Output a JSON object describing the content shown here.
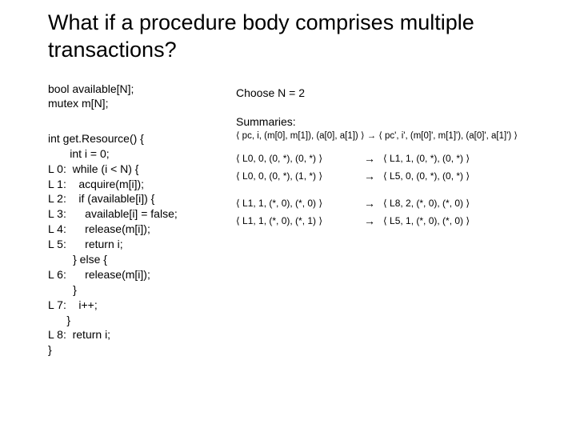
{
  "title": "What if a procedure body comprises multiple transactions?",
  "decl": {
    "line1": "bool available[N];",
    "line2": "mutex m[N];"
  },
  "code": "int get.Resource() {\n       int i = 0;\nL 0:  while (i < N) {\nL 1:    acquire(m[i]);\nL 2:    if (available[i]) {\nL 3:      available[i] = false;\nL 4:      release(m[i]);\nL 5:      return i;\n        } else {\nL 6:      release(m[i]);\n        }\nL 7:    i++;\n      }\nL 8:  return i;\n}",
  "choose": "Choose N = 2",
  "summaries_label": "Summaries:",
  "sum_first": "⟨ pc, i, (m[0], m[1]), (a[0], a[1]) ⟩ → ⟨ pc', i', (m[0]', m[1]'), (a[0]', a[1]') ⟩",
  "group1": {
    "row1": {
      "lhs": "⟨ L0, 0, (0, *), (0, *) ⟩",
      "rhs": "⟨ L1, 1, (0, *), (0, *) ⟩"
    },
    "row2": {
      "lhs": "⟨ L0, 0, (0, *), (1, *) ⟩",
      "rhs": "⟨ L5, 0, (0, *), (0, *) ⟩"
    }
  },
  "group2": {
    "row1": {
      "lhs": "⟨ L1, 1, (*, 0), (*, 0) ⟩",
      "rhs": "⟨ L8, 2, (*, 0), (*, 0) ⟩"
    },
    "row2": {
      "lhs": "⟨ L1, 1, (*, 0), (*, 1) ⟩",
      "rhs": "⟨ L5, 1, (*, 0), (*, 0) ⟩"
    }
  },
  "arrow": "→"
}
